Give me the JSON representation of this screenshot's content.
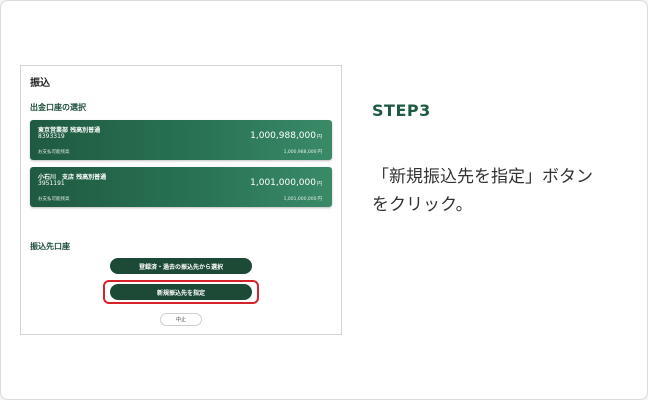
{
  "screen": {
    "title": "振込",
    "source_section": "出金口座の選択",
    "accounts": [
      {
        "name": "東京営業部 残高別普通",
        "number": "8393319",
        "balance": "1,000,988,000",
        "yen": "円",
        "available_label": "お支払可能残高",
        "available": "1,000,988,000",
        "available_yen": "円"
      },
      {
        "name": "小石川　支店 残高別普通",
        "number": "3951191",
        "balance": "1,001,000,000",
        "yen": "円",
        "available_label": "お支払可能残高",
        "available": "1,001,000,000",
        "available_yen": "円"
      }
    ],
    "dest_section": "振込先口座",
    "select_registered_label": "登録済・過去の振込先から選択",
    "new_dest_label": "新規振込先を指定",
    "cancel_label": "中止"
  },
  "instruction": {
    "step": "STEP3",
    "line1": "「新規振込先を指定」ボタン",
    "line2": "をクリック。"
  },
  "colors": {
    "brand_green": "#1c4a36",
    "highlight_red": "#d9212c"
  }
}
